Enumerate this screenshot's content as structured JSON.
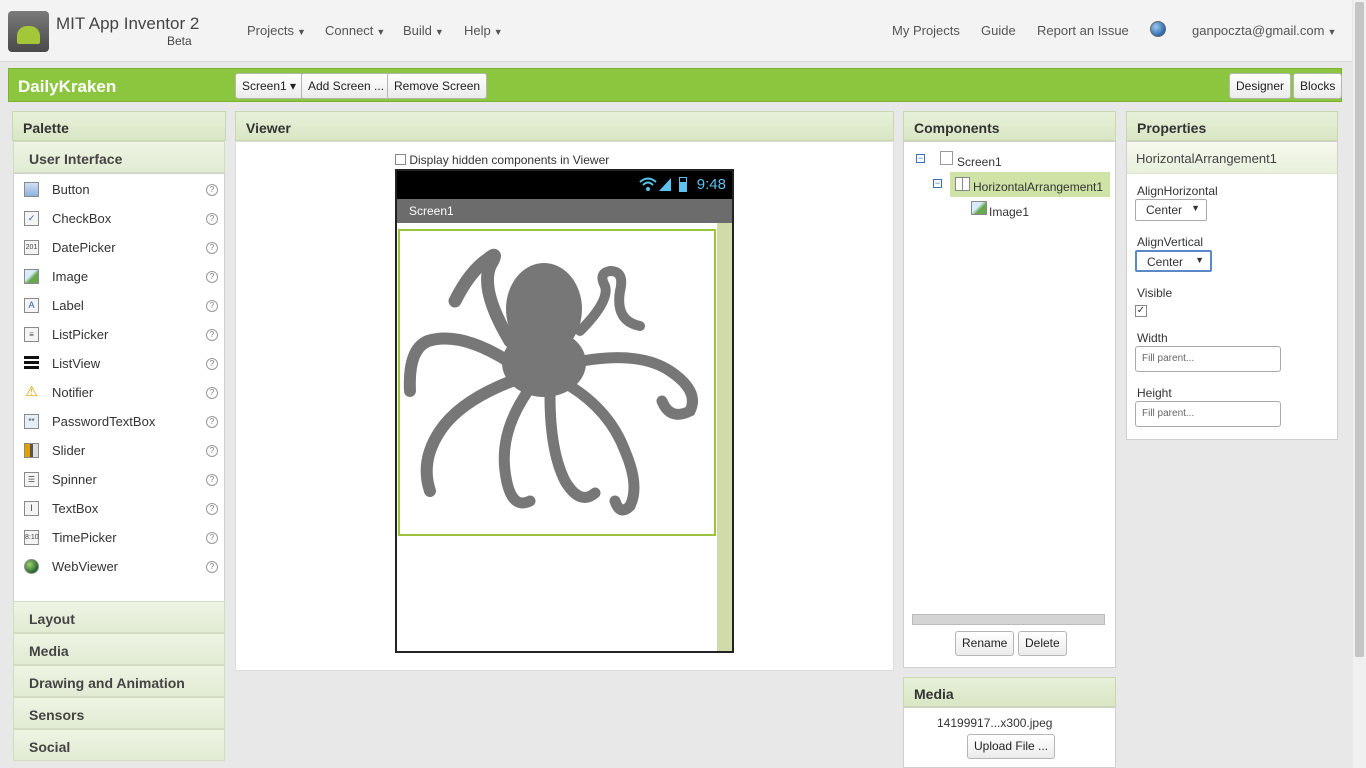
{
  "brand": {
    "title": "MIT App Inventor 2",
    "subtitle": "Beta"
  },
  "topnav": {
    "left": [
      "Projects",
      "Connect",
      "Build",
      "Help"
    ],
    "right": [
      "My Projects",
      "Guide",
      "Report an Issue"
    ],
    "account": "ganpoczta@gmail.com"
  },
  "project": {
    "name": "DailyKraken",
    "screen_select": "Screen1 ▾",
    "add_screen": "Add Screen ...",
    "remove_screen": "Remove Screen",
    "designer": "Designer",
    "blocks": "Blocks"
  },
  "palette": {
    "title": "Palette",
    "section": "User Interface",
    "items": [
      {
        "label": "Button",
        "icon": "button-icon"
      },
      {
        "label": "CheckBox",
        "icon": "checkbox-icon"
      },
      {
        "label": "DatePicker",
        "icon": "datepicker-icon"
      },
      {
        "label": "Image",
        "icon": "image-icon"
      },
      {
        "label": "Label",
        "icon": "label-icon"
      },
      {
        "label": "ListPicker",
        "icon": "listpicker-icon"
      },
      {
        "label": "ListView",
        "icon": "listview-icon"
      },
      {
        "label": "Notifier",
        "icon": "notifier-icon"
      },
      {
        "label": "PasswordTextBox",
        "icon": "passwordtextbox-icon"
      },
      {
        "label": "Slider",
        "icon": "slider-icon"
      },
      {
        "label": "Spinner",
        "icon": "spinner-icon"
      },
      {
        "label": "TextBox",
        "icon": "textbox-icon"
      },
      {
        "label": "TimePicker",
        "icon": "timepicker-icon"
      },
      {
        "label": "WebViewer",
        "icon": "webviewer-icon"
      }
    ],
    "collapsed": [
      "Layout",
      "Media",
      "Drawing and Animation",
      "Sensors",
      "Social"
    ]
  },
  "viewer": {
    "title": "Viewer",
    "hidden_checkbox_label": "Display hidden components in Viewer",
    "clock": "9:48",
    "screen_title": "Screen1"
  },
  "components": {
    "title": "Components",
    "tree": [
      "Screen1",
      "HorizontalArrangement1",
      "Image1"
    ],
    "rename": "Rename",
    "delete": "Delete"
  },
  "media": {
    "title": "Media",
    "file": "14199917...x300.jpeg",
    "upload": "Upload File ..."
  },
  "properties": {
    "title": "Properties",
    "component": "HorizontalArrangement1",
    "align_horizontal_label": "AlignHorizontal",
    "align_horizontal_value": "Center",
    "align_vertical_label": "AlignVertical",
    "align_vertical_value": "Center",
    "visible_label": "Visible",
    "visible_checked": true,
    "width_label": "Width",
    "width_value": "Fill parent...",
    "height_label": "Height",
    "height_value": "Fill parent..."
  },
  "colors": {
    "accent": "#8cc63f",
    "panel_header": "#dfe9cc"
  }
}
